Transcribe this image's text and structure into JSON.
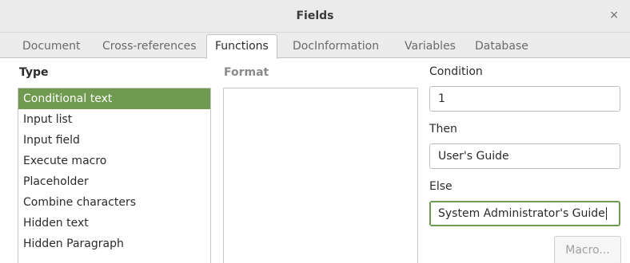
{
  "window": {
    "title": "Fields",
    "close_glyph": "×"
  },
  "tabs": [
    {
      "label": "Document",
      "active": false
    },
    {
      "label": "Cross-references",
      "active": false
    },
    {
      "label": "Functions",
      "active": true
    },
    {
      "label": "DocInformation",
      "active": false
    },
    {
      "label": "Variables",
      "active": false
    },
    {
      "label": "Database",
      "active": false
    }
  ],
  "type_panel": {
    "header": "Type",
    "items": [
      {
        "label": "Conditional text",
        "selected": true
      },
      {
        "label": "Input list",
        "selected": false
      },
      {
        "label": "Input field",
        "selected": false
      },
      {
        "label": "Execute macro",
        "selected": false
      },
      {
        "label": "Placeholder",
        "selected": false
      },
      {
        "label": "Combine characters",
        "selected": false
      },
      {
        "label": "Hidden text",
        "selected": false
      },
      {
        "label": "Hidden Paragraph",
        "selected": false
      }
    ]
  },
  "format_panel": {
    "header": "Format",
    "items": []
  },
  "condition_panel": {
    "condition_label": "Condition",
    "condition_value": "1",
    "then_label": "Then",
    "then_value": "User's Guide",
    "else_label": "Else",
    "else_value": "System Administrator's Guide",
    "macro_button": "Macro..."
  },
  "colors": {
    "selection": "#6f9a4f",
    "focus_border": "#6f9a4f"
  }
}
